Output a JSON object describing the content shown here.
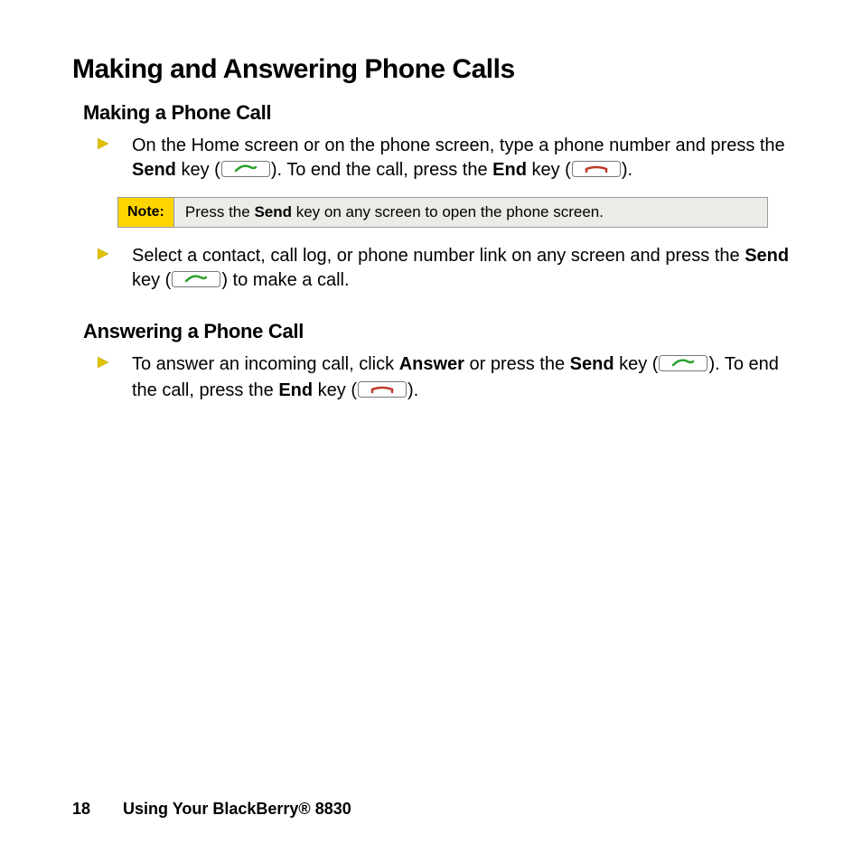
{
  "title": "Making and Answering Phone Calls",
  "sections": {
    "making": {
      "heading": "Making a Phone Call",
      "bullets": {
        "b1": {
          "p1": "On the Home screen or on the phone screen, type a phone number and press the ",
          "sendLabel": "Send",
          "p2": " key (",
          "p3": "). To end the call, press the ",
          "endLabel": "End",
          "p4": " key (",
          "p5": ")."
        },
        "b2": {
          "p1": "Select a contact, call log, or phone number link on any screen and press the ",
          "sendLabel": "Send",
          "p2": " key (",
          "p3": ") to make a call."
        }
      },
      "note": {
        "label": "Note:",
        "pre": "Press the ",
        "bold": "Send",
        "post": " key on any screen to open the phone screen."
      }
    },
    "answering": {
      "heading": "Answering a Phone Call",
      "bullets": {
        "b1": {
          "p1": "To answer an incoming call, click ",
          "answerLabel": "Answer",
          "p2": " or press the ",
          "sendLabel": "Send",
          "p3": " key (",
          "p4": "). To end the call, press the ",
          "endLabel": "End",
          "p5": " key (",
          "p6": ")."
        }
      }
    }
  },
  "footer": {
    "pageNumber": "18",
    "bookTitle": "Using Your BlackBerry® 8830"
  }
}
